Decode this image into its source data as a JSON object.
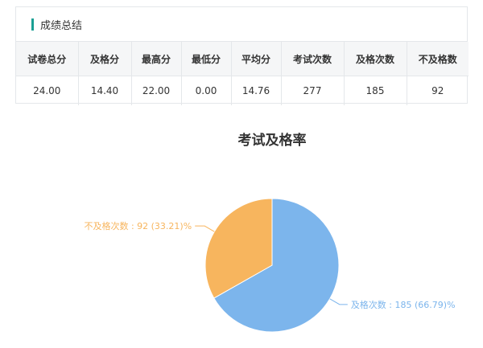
{
  "summary": {
    "title": "成绩总结",
    "accent_color": "#1aa094",
    "headers": [
      "试卷总分",
      "及格分",
      "最高分",
      "最低分",
      "平均分",
      "考试次数",
      "及格次数",
      "不及格数"
    ],
    "values": [
      "24.00",
      "14.40",
      "22.00",
      "0.00",
      "14.76",
      "277",
      "185",
      "92"
    ]
  },
  "chart_data": {
    "type": "pie",
    "title": "考试及格率",
    "slices": [
      {
        "name": "及格次数",
        "value": 185,
        "percent": "66.79",
        "color": "#7cb5ec",
        "label": "及格次数 : 185 (66.79)%"
      },
      {
        "name": "不及格次数",
        "value": 92,
        "percent": "33.21",
        "color": "#f7b55e",
        "label": "不及格次数 : 92 (33.21)%"
      }
    ]
  }
}
